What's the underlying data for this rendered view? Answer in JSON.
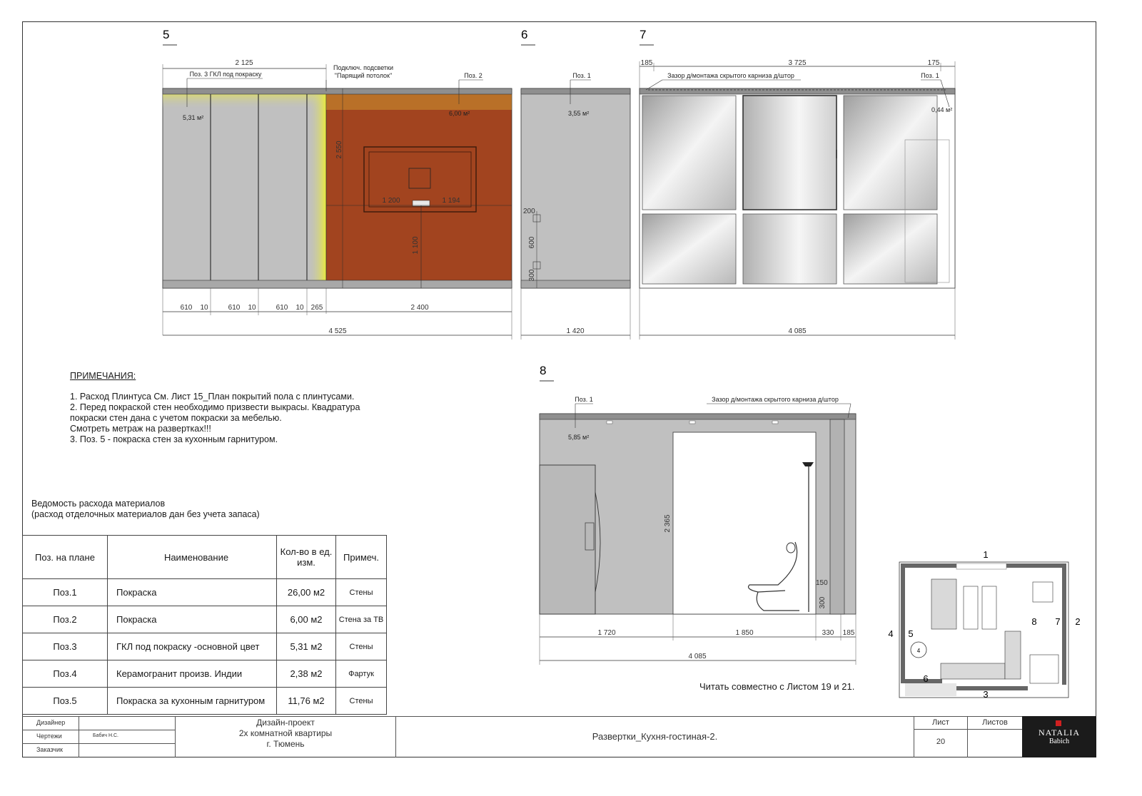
{
  "views": {
    "v5": {
      "number": "5",
      "dims_top": "2 125",
      "label_gkl": "Поз. 3 ГКЛ под покраску",
      "label_light_1": "Подключ. подсветки",
      "label_light_2": "\"Парящий потолок\"",
      "label_poz2": "Поз. 2",
      "area_gkl": "5,31 м²",
      "area_tv": "6,00 м²",
      "dim_height": "2 550",
      "dim_1200": "1 200",
      "dim_1194": "1 194",
      "dim_1100": "1 100",
      "dims_bottom": [
        "610",
        "10",
        "610",
        "10",
        "610",
        "10",
        "265",
        "2 400"
      ],
      "dim_total": "4 525"
    },
    "v6": {
      "number": "6",
      "label_poz1": "Поз. 1",
      "area": "3,55 м²",
      "dim_200": "200",
      "dim_600": "600",
      "dim_300": "300",
      "dim_total": "1 420"
    },
    "v7": {
      "number": "7",
      "dim_185": "185",
      "dim_3725": "3 725",
      "dim_175": "175",
      "label_cornice": "Зазор д/монтажа скрытого карниза д/штор",
      "label_poz1": "Поз. 1",
      "area": "0,44 м²",
      "dim_total": "4 085"
    },
    "v8": {
      "number": "8",
      "label_poz1": "Поз. 1",
      "label_cornice": "Зазор д/монтажа скрытого карниза д/штор",
      "area": "5,85 м²",
      "dim_height": "2 365",
      "dim_150": "150",
      "dim_300": "300",
      "dims_bottom": [
        "1 720",
        "1 850",
        "330",
        "185"
      ],
      "dim_total": "4 085"
    }
  },
  "notes": {
    "title": "ПРИМЕЧАНИЯ:",
    "lines": [
      "1.  Расход Плинтуса  См. Лист 15_План покрытий пола с плинтусами.",
      "2. Перед покраской стен необходимо призвести выкрасы. Квадратура",
      "покраски стен дана с учетом покраски за  мебелью.",
      "Смотреть метраж на развертках!!!",
      "3. Поз. 5 - покраска стен за кухонным гарнитуром."
    ]
  },
  "vedomost": {
    "title_1": "Ведомость расхода материалов",
    "title_2": "(расход отделочных материалов дан без учета запаса)"
  },
  "materials_table": {
    "headers": [
      "Поз. на плане",
      "Наименование",
      "Кол-во в ед. изм.",
      "Примеч."
    ],
    "rows": [
      {
        "pos": "Поз.1",
        "name": "Покраска",
        "qty": "26,00 м2",
        "note": "Стены"
      },
      {
        "pos": "Поз.2",
        "name": "Покраска",
        "qty": "6,00 м2",
        "note": "Стена за ТВ"
      },
      {
        "pos": "Поз.3",
        "name": "ГКЛ под покраску -основной цвет",
        "qty": "5,31 м2",
        "note": "Стены"
      },
      {
        "pos": "Поз.4",
        "name": "Керамогранит произв. Индии",
        "qty": "2,38 м2",
        "note": "Фартук"
      },
      {
        "pos": "Поз.5",
        "name": "Покраска за кухонным гарнитуром",
        "qty": "11,76 м2",
        "note": "Стены"
      }
    ]
  },
  "read_together": "Читать совместно с Листом 19 и 21.",
  "key_plan": {
    "labels": [
      "1",
      "2",
      "3",
      "4",
      "5",
      "6",
      "7",
      "8"
    ],
    "circle": "4"
  },
  "title_block": {
    "roles": [
      "Дизайнер",
      "Чертежи",
      "Заказчик"
    ],
    "drafter_name": "Бабич Н.С.",
    "project_1": "Дизайн-проект",
    "project_2": "2х комнатной квартиры",
    "project_3": "г. Тюмень",
    "sheet_title": "Развертки_Кухня-гостиная-2.",
    "list_label": "Лист",
    "listov_label": "Листов",
    "list_number": "20",
    "logo_1": "NATALIA",
    "logo_2": "Babich"
  },
  "colors": {
    "wall_gray": "#c0c0c0",
    "tv_wall": "#a2441f",
    "glow": "#f2f07a",
    "line": "#333333"
  }
}
